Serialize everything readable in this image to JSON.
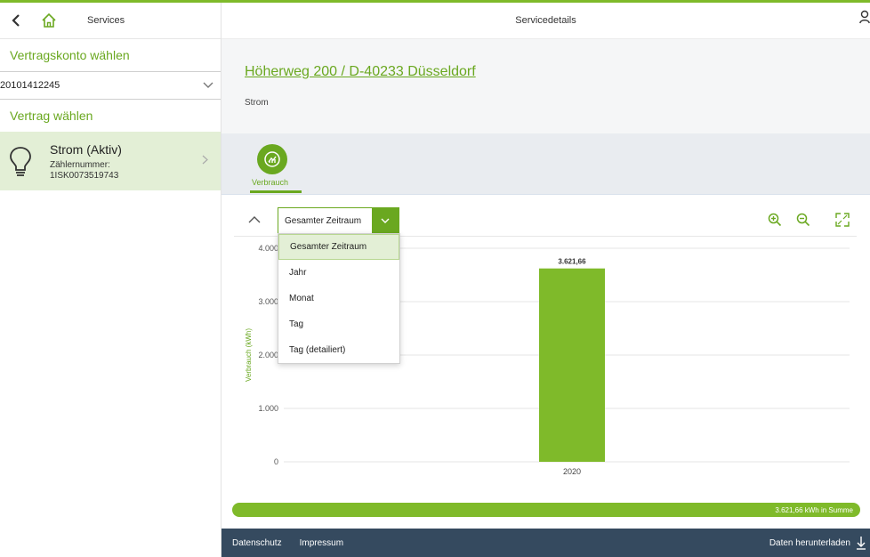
{
  "sidebar": {
    "title": "Services",
    "account_label": "Vertragskonto wählen",
    "account_value": "20101412245",
    "contract_label": "Vertrag wählen",
    "contract": {
      "title": "Strom (Aktiv)",
      "meter_label": "Zählernummer:",
      "meter_value": "1ISK0073519743"
    }
  },
  "main": {
    "title": "Servicedetails",
    "address": "Höherweg 200 / D-40233 Düsseldorf",
    "energy_type": "Strom",
    "tab_label": "Verbrauch",
    "period": {
      "selected": "Gesamter Zeitraum",
      "options": [
        "Gesamter Zeitraum",
        "Jahr",
        "Monat",
        "Tag",
        "Tag (detailiert)"
      ]
    },
    "summary": "3.621,66 kWh in Summe"
  },
  "footer": {
    "privacy": "Datenschutz",
    "imprint": "Impressum",
    "download": "Daten herunterladen"
  },
  "colors": {
    "accent": "#7fba2a",
    "accent_dark": "#6aa820",
    "selection": "#e3efd6",
    "footer": "#354a5f"
  },
  "chart_data": {
    "type": "bar",
    "categories": [
      "2020"
    ],
    "values": [
      3621.66
    ],
    "value_labels": [
      "3.621,66"
    ],
    "ylabel": "Verbrauch (kWh)",
    "ylim": [
      0,
      4000
    ],
    "yticks": [
      0,
      1000,
      2000,
      3000,
      4000
    ],
    "ytick_labels": [
      "0",
      "1.000",
      "2.000",
      "3.000",
      "4.000"
    ],
    "grid": true,
    "color": "#7fba2a"
  }
}
